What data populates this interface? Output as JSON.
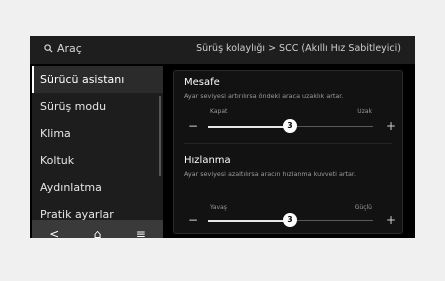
{
  "topbar": {
    "search_label": "Araç",
    "breadcrumb": "Sürüş kolaylığı > SCC (Akıllı Hız Sabitleyici)"
  },
  "sidebar": {
    "items": [
      {
        "label": "Sürücü asistanı"
      },
      {
        "label": "Sürüş modu"
      },
      {
        "label": "Klima"
      },
      {
        "label": "Koltuk"
      },
      {
        "label": "Aydınlatma"
      },
      {
        "label": "Pratik ayarlar"
      }
    ]
  },
  "navbar": {
    "back": "<",
    "home": "⌂",
    "menu": "≡"
  },
  "settings": {
    "distance": {
      "title": "Mesafe",
      "description": "Ayar seviyesi artırılırsa öndeki araca uzaklık artar.",
      "min_label": "Kapat",
      "max_label": "Uzak",
      "value": "3",
      "minus": "−",
      "plus": "+"
    },
    "acceleration": {
      "title": "Hızlanma",
      "description": "Ayar seviyesi azaltılırsa aracın hızlanma kuvveti artar.",
      "min_label": "Yavaş",
      "max_label": "Güçlü",
      "value": "3",
      "minus": "−",
      "plus": "+"
    }
  }
}
